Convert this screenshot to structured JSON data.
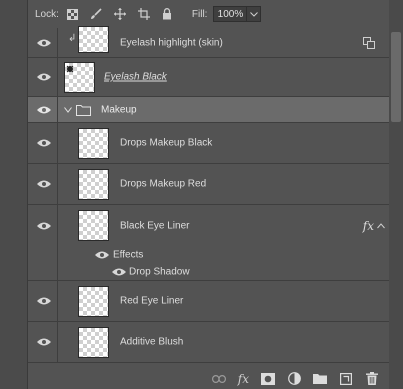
{
  "lock_row": {
    "lock_label": "Lock:",
    "fill_label": "Fill:",
    "fill_value": "100%"
  },
  "layers": {
    "eyelash_highlight": "Eyelash highlight (skin)",
    "eyelash_black": "Eyelash Black",
    "makeup_group": "Makeup",
    "drops_black": "Drops Makeup Black",
    "drops_red": "Drops Makeup Red",
    "black_liner": "Black Eye Liner",
    "effects_label": "Effects",
    "drop_shadow": "Drop Shadow",
    "red_liner": "Red Eye Liner",
    "additive_blush": "Additive Blush"
  },
  "fx_glyph": "fx",
  "toolbar": {
    "icons": [
      "link-icon",
      "fx-icon",
      "mask-icon",
      "adjustment-icon",
      "folder-icon",
      "new-layer-icon",
      "trash-icon"
    ]
  }
}
